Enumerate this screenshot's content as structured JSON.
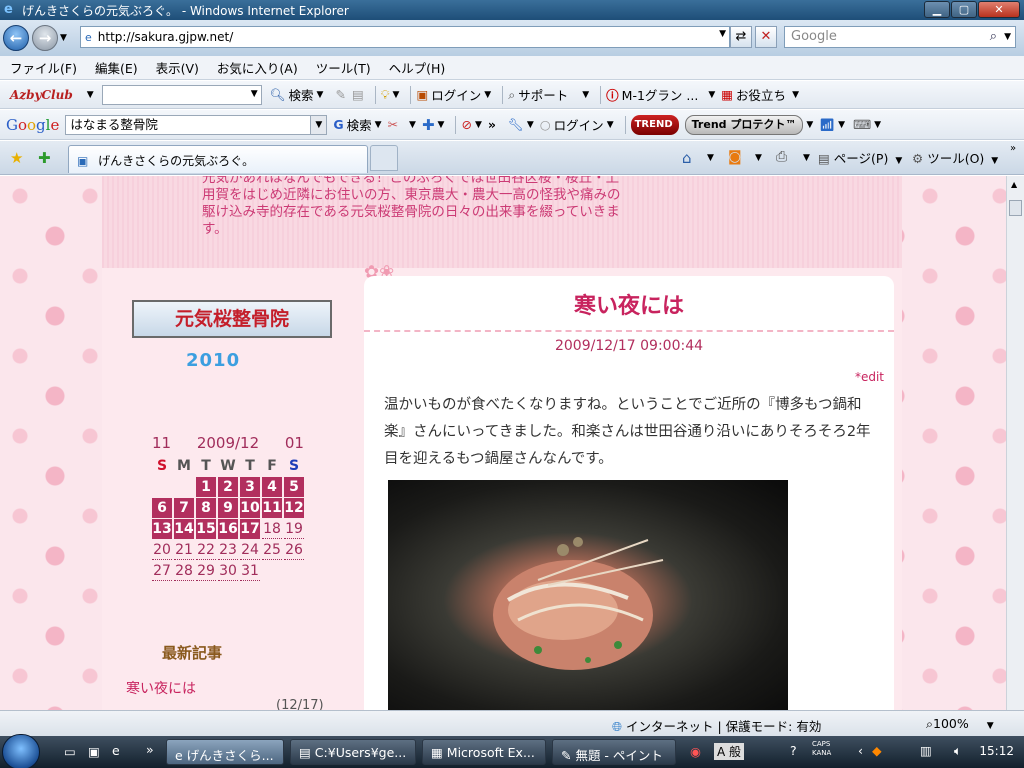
{
  "window": {
    "title": "げんきさくらの元気ぶろぐ。 - Windows Internet Explorer"
  },
  "address": {
    "url": "http://sakura.gjpw.net/",
    "search_placeholder": "Google"
  },
  "menu": [
    "ファイル(F)",
    "編集(E)",
    "表示(V)",
    "お気に入り(A)",
    "ツール(T)",
    "ヘルプ(H)"
  ],
  "azby_toolbar": {
    "logo": "AzbyClub",
    "search_label": "検索",
    "login_label": "ログイン",
    "support_label": "サポート",
    "m1_label": "M-1グラン ...",
    "useful_label": "お役立ち"
  },
  "google_toolbar": {
    "logo": "Google",
    "query": "はなまる整骨院",
    "search_label": "検索",
    "login_label": "ログイン",
    "trend_logo": "TREND",
    "trend_button": "Trend プロテクト™"
  },
  "tabs": {
    "active_tab": "げんきさくらの元気ぶろぐ。",
    "page_label": "ページ(P)",
    "tools_label": "ツール(O)"
  },
  "blog": {
    "header_text": "元気があればなんでもできる！このぶろぐでは世田谷区桜・桜丘・上用賀をはじめ近隣にお住いの方、東京農大・農大一高の怪我や痛みの駆け込み寺的存在である元気桜整骨院の日々の出来事を綴っていきます。",
    "banner_text": "元気桜整骨院",
    "year_badge": "2010",
    "calendar": {
      "prev": "11",
      "current": "2009/12",
      "next": "01",
      "weekdays": [
        "S",
        "M",
        "T",
        "W",
        "T",
        "F",
        "S"
      ],
      "weeks": [
        [
          "",
          "",
          "1",
          "2",
          "3",
          "4",
          "5"
        ],
        [
          "6",
          "7",
          "8",
          "9",
          "10",
          "11",
          "12"
        ],
        [
          "13",
          "14",
          "15",
          "16",
          "17",
          "18",
          "19"
        ],
        [
          "20",
          "21",
          "22",
          "23",
          "24",
          "25",
          "26"
        ],
        [
          "27",
          "28",
          "29",
          "30",
          "31",
          "",
          ""
        ]
      ],
      "highlighted_days": [
        "1",
        "2",
        "3",
        "4",
        "5",
        "6",
        "7",
        "8",
        "9",
        "10",
        "11",
        "12",
        "13",
        "14",
        "15",
        "16",
        "17"
      ]
    },
    "latest_heading": "最新記事",
    "latest_item_title": "寒い夜には",
    "latest_item_date": "(12/17)",
    "post": {
      "title": "寒い夜には",
      "date": "2009/12/17 09:00:44",
      "edit_link": "*edit",
      "body": "温かいものが食べたくなりますね。ということでご近所の『博多もつ鍋和楽』さんにいってきました。和楽さんは世田谷通り沿いにありそろそろ2年目を迎えるもつ鍋屋さんなんです。"
    }
  },
  "status": {
    "zone": "インターネット | 保護モード: 有効",
    "zoom": "100%"
  },
  "taskbar": {
    "tasks": [
      "げんきさくら...",
      "C:¥Users¥ge...",
      "Microsoft Ex...",
      "無題 - ペイント"
    ],
    "ime": "A 般",
    "clock": "15:12"
  },
  "colors": {
    "accent_pink": "#c8235e",
    "calendar_highlight": "#b22f5e",
    "title_bar": "#1e4e78"
  }
}
